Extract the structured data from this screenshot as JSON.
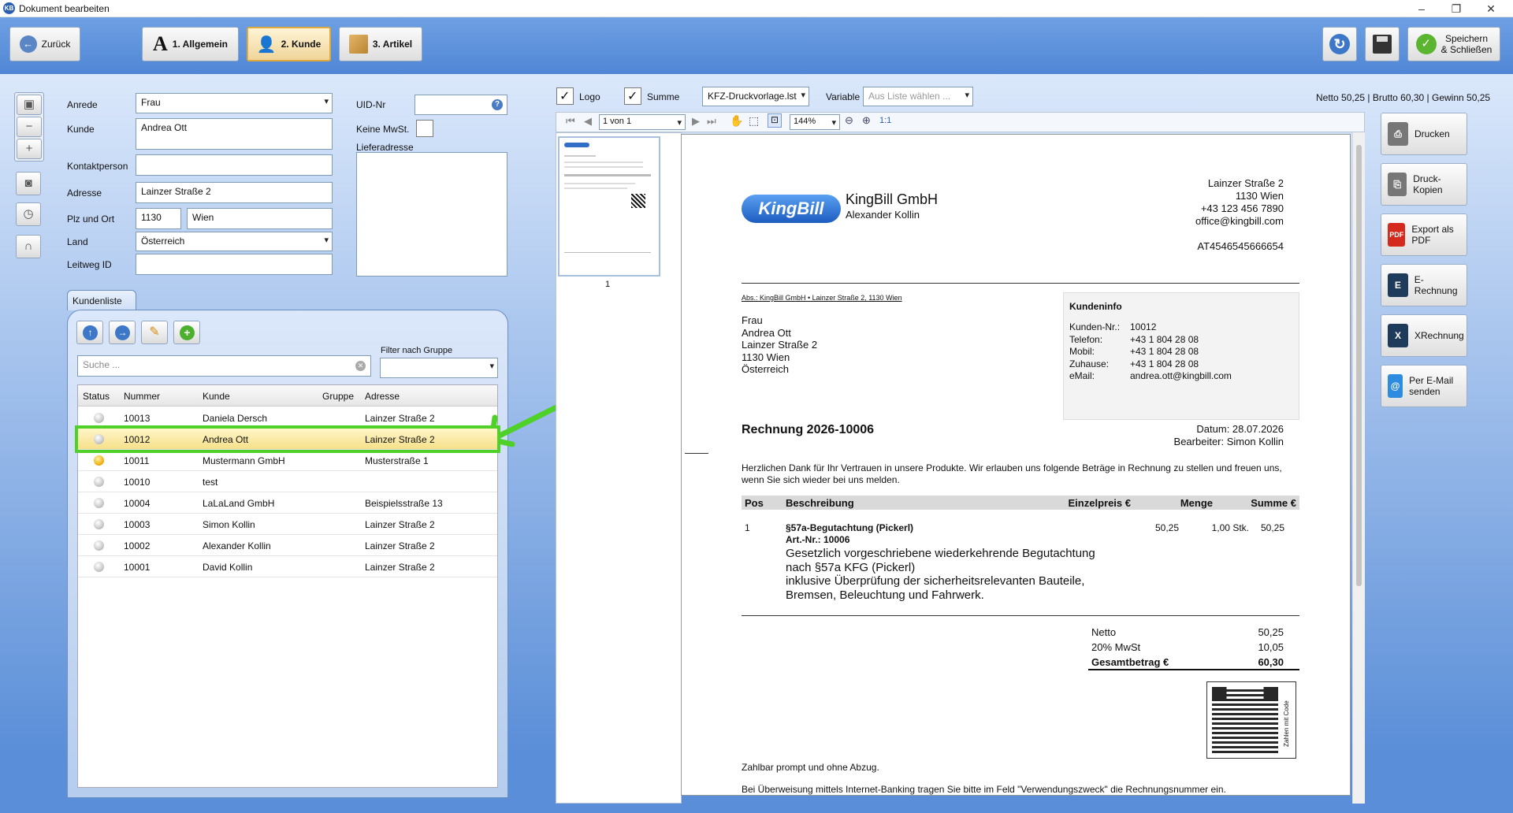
{
  "window": {
    "title": "Dokument bearbeiten",
    "icon": "KB"
  },
  "toolbar": {
    "back": "Zurück",
    "tab1": "1. Allgemein",
    "tab2": "2. Kunde",
    "tab3": "3. Artikel",
    "save_close_1": "Speichern",
    "save_close_2": "& Schließen"
  },
  "form": {
    "anrede_label": "Anrede",
    "anrede": "Frau",
    "kunde_label": "Kunde",
    "kunde": "Andrea Ott",
    "kontakt_label": "Kontaktperson",
    "kontakt": "",
    "adresse_label": "Adresse",
    "adresse": "Lainzer Straße  2",
    "plz_label": "Plz und Ort",
    "plz": "1130",
    "ort": "Wien",
    "land_label": "Land",
    "land": "Österreich",
    "leitweg_label": "Leitweg ID",
    "leitweg": "",
    "uid_label": "UID-Nr",
    "uid": "",
    "keine_mwst_label": "Keine MwSt.",
    "lieferadresse_label": "Lieferadresse"
  },
  "kundenliste": {
    "tab": "Kundenliste",
    "filter_label": "Filter nach Gruppe",
    "search_placeholder": "Suche ...",
    "columns": [
      "Status",
      "Nummer",
      "Kunde",
      "Gruppe",
      "Adresse"
    ],
    "rows": [
      {
        "status": "grey",
        "nummer": "10013",
        "kunde": "Daniela Dersch",
        "gruppe": "",
        "adresse": "Lainzer Straße 2"
      },
      {
        "status": "grey",
        "nummer": "10012",
        "kunde": "Andrea Ott",
        "gruppe": "",
        "adresse": "Lainzer Straße  2"
      },
      {
        "status": "yellow",
        "nummer": "10011",
        "kunde": "Mustermann GmbH",
        "gruppe": "",
        "adresse": "Musterstraße 1"
      },
      {
        "status": "grey",
        "nummer": "10010",
        "kunde": "test",
        "gruppe": "",
        "adresse": ""
      },
      {
        "status": "grey",
        "nummer": "10004",
        "kunde": "LaLaLand GmbH",
        "gruppe": "",
        "adresse": "Beispielsstraße 13"
      },
      {
        "status": "grey",
        "nummer": "10003",
        "kunde": "Simon Kollin",
        "gruppe": "",
        "adresse": "Lainzer Straße 2"
      },
      {
        "status": "grey",
        "nummer": "10002",
        "kunde": "Alexander Kollin",
        "gruppe": "",
        "adresse": "Lainzer Straße 2"
      },
      {
        "status": "grey",
        "nummer": "10001",
        "kunde": "David Kollin",
        "gruppe": "",
        "adresse": "Lainzer Straße 2"
      }
    ]
  },
  "preview_bar": {
    "logo": "Logo",
    "summe": "Summe",
    "template": "KFZ-Druckvorlage.lst",
    "variable_label": "Variable",
    "variable_placeholder": "Aus Liste wählen ...",
    "totals": "Netto 50,25 | Brutto 60,30 | Gewinn 50,25",
    "page": "1 von 1",
    "zoom": "144%",
    "ratio": "1:1",
    "thumb_page": "1"
  },
  "actions": [
    "Drucken",
    "Druck-Kopien",
    "Export als PDF",
    "E-Rechnung",
    "XRechnung",
    "Per E-Mail senden"
  ],
  "invoice": {
    "company": "KingBill GmbH",
    "logo_text": "KingBill",
    "person": "Alexander Kollin",
    "sender_addr": [
      "Lainzer Straße 2",
      "1130 Wien",
      "+43 123 456 7890",
      "office@kingbill.com",
      "",
      "AT4546545666654"
    ],
    "abs": "Abs.: KingBill GmbH • Lainzer Straße 2, 1130 Wien",
    "recipient": [
      "Frau",
      "Andrea Ott",
      "Lainzer Straße 2",
      "1130 Wien",
      "Österreich"
    ],
    "kundeninfo_title": "Kundeninfo",
    "kundeninfo": [
      [
        "Kunden-Nr.:",
        "10012"
      ],
      [
        "Telefon:",
        "+43 1 804 28 08"
      ],
      [
        "Mobil:",
        "+43 1 804 28 08"
      ],
      [
        "Zuhause:",
        "+43 1 804 28 08"
      ],
      [
        "eMail:",
        "andrea.ott@kingbill.com"
      ]
    ],
    "title": "Rechnung 2026-10006",
    "datum": "Datum: 28.07.2026",
    "bearbeiter": "Bearbeiter: Simon Kollin",
    "intro": "Herzlichen Dank für Ihr Vertrauen in unsere Produkte. Wir erlauben uns folgende Beträge in Rechnung zu stellen und freuen uns, wenn Sie sich wieder bei uns melden.",
    "table_head": [
      "Pos",
      "Beschreibung",
      "Einzelpreis €",
      "Menge",
      "Summe €"
    ],
    "item": {
      "pos": "1",
      "name": "§57a-Begutachtung (Pickerl)",
      "artnr": "Art.-Nr.: 10006",
      "desc": [
        "Gesetzlich vorgeschriebene wiederkehrende Begutachtung",
        "nach §57a KFG (Pickerl)",
        "inklusive Überprüfung der sicherheitsrelevanten Bauteile,",
        "Bremsen, Beleuchtung und Fahrwerk."
      ],
      "price": "50,25",
      "qty": "1,00 Stk.",
      "sum": "50,25"
    },
    "netto_label": "Netto",
    "netto": "50,25",
    "mwst_label": "20% MwSt",
    "mwst": "10,05",
    "gesamt_label": "Gesamtbetrag €",
    "gesamt": "60,30",
    "qr_label": "Zahlen mit Code",
    "zahlbar": "Zahlbar prompt und ohne Abzug.",
    "ueberweisung": "Bei Überweisung mittels Internet-Banking tragen Sie bitte im Feld \"Verwendungszweck\" die Rechnungsnummer ein."
  }
}
